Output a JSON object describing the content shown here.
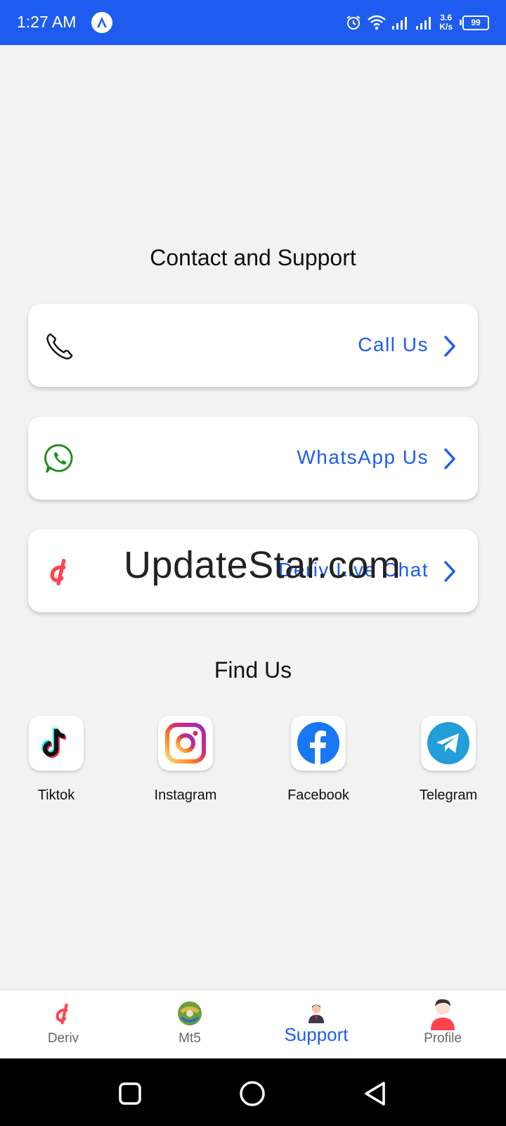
{
  "status_bar": {
    "time": "1:27 AM",
    "speed_value": "3.6",
    "speed_unit": "K/s",
    "battery": "99",
    "icons": [
      "app-logo-icon",
      "alarm-icon",
      "wifi-icon",
      "signal-icon",
      "signal-icon",
      "battery-icon"
    ]
  },
  "contact": {
    "title": "Contact and Support",
    "items": [
      {
        "label": "Call Us",
        "icon": "phone-icon"
      },
      {
        "label": "WhatsApp Us",
        "icon": "whatsapp-icon"
      },
      {
        "label": "Deriv Live Chat",
        "icon": "deriv-logo-icon"
      }
    ]
  },
  "watermark": "UpdateStar.com",
  "find_us": {
    "title": "Find Us",
    "items": [
      {
        "label": "Tiktok",
        "icon": "tiktok-icon"
      },
      {
        "label": "Instagram",
        "icon": "instagram-icon"
      },
      {
        "label": "Facebook",
        "icon": "facebook-icon"
      },
      {
        "label": "Telegram",
        "icon": "telegram-icon"
      }
    ]
  },
  "bottom_nav": {
    "items": [
      {
        "label": "Deriv",
        "icon": "deriv-logo-icon"
      },
      {
        "label": "Mt5",
        "icon": "mt5-icon"
      },
      {
        "label": "Support",
        "icon": "support-agent-icon",
        "active": true
      },
      {
        "label": "Profile",
        "icon": "profile-avatar-icon"
      }
    ]
  },
  "colors": {
    "accent": "#1e5cf0",
    "background": "#f2f2f2",
    "deriv_red": "#ff444f",
    "whatsapp_green": "#1a8d1a"
  }
}
